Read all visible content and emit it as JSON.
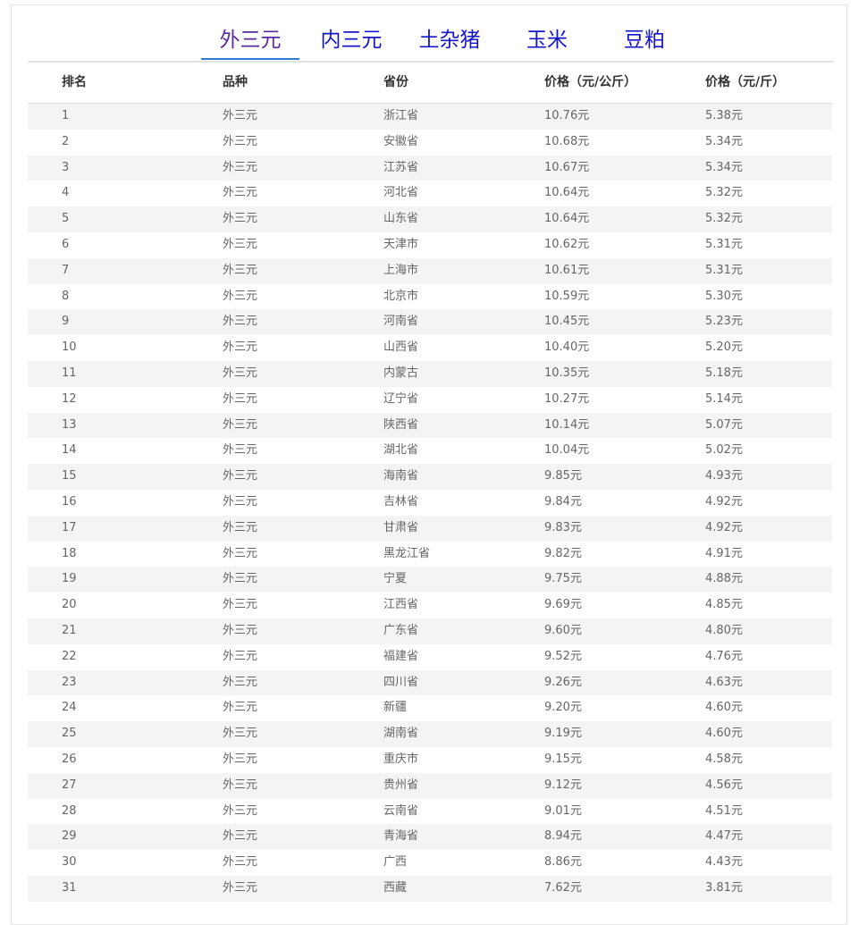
{
  "tabs": [
    {
      "label": "外三元",
      "active": true
    },
    {
      "label": "内三元",
      "active": false
    },
    {
      "label": "土杂猪",
      "active": false
    },
    {
      "label": "玉米",
      "active": false
    },
    {
      "label": "豆粕",
      "active": false
    }
  ],
  "table": {
    "headers": [
      "排名",
      "品种",
      "省份",
      "价格（元/公斤）",
      "价格（元/斤）"
    ],
    "rows": [
      [
        "1",
        "外三元",
        "浙江省",
        "10.76元",
        "5.38元"
      ],
      [
        "2",
        "外三元",
        "安徽省",
        "10.68元",
        "5.34元"
      ],
      [
        "3",
        "外三元",
        "江苏省",
        "10.67元",
        "5.34元"
      ],
      [
        "4",
        "外三元",
        "河北省",
        "10.64元",
        "5.32元"
      ],
      [
        "5",
        "外三元",
        "山东省",
        "10.64元",
        "5.32元"
      ],
      [
        "6",
        "外三元",
        "天津市",
        "10.62元",
        "5.31元"
      ],
      [
        "7",
        "外三元",
        "上海市",
        "10.61元",
        "5.31元"
      ],
      [
        "8",
        "外三元",
        "北京市",
        "10.59元",
        "5.30元"
      ],
      [
        "9",
        "外三元",
        "河南省",
        "10.45元",
        "5.23元"
      ],
      [
        "10",
        "外三元",
        "山西省",
        "10.40元",
        "5.20元"
      ],
      [
        "11",
        "外三元",
        "内蒙古",
        "10.35元",
        "5.18元"
      ],
      [
        "12",
        "外三元",
        "辽宁省",
        "10.27元",
        "5.14元"
      ],
      [
        "13",
        "外三元",
        "陕西省",
        "10.14元",
        "5.07元"
      ],
      [
        "14",
        "外三元",
        "湖北省",
        "10.04元",
        "5.02元"
      ],
      [
        "15",
        "外三元",
        "海南省",
        "9.85元",
        "4.93元"
      ],
      [
        "16",
        "外三元",
        "吉林省",
        "9.84元",
        "4.92元"
      ],
      [
        "17",
        "外三元",
        "甘肃省",
        "9.83元",
        "4.92元"
      ],
      [
        "18",
        "外三元",
        "黑龙江省",
        "9.82元",
        "4.91元"
      ],
      [
        "19",
        "外三元",
        "宁夏",
        "9.75元",
        "4.88元"
      ],
      [
        "20",
        "外三元",
        "江西省",
        "9.69元",
        "4.85元"
      ],
      [
        "21",
        "外三元",
        "广东省",
        "9.60元",
        "4.80元"
      ],
      [
        "22",
        "外三元",
        "福建省",
        "9.52元",
        "4.76元"
      ],
      [
        "23",
        "外三元",
        "四川省",
        "9.26元",
        "4.63元"
      ],
      [
        "24",
        "外三元",
        "新疆",
        "9.20元",
        "4.60元"
      ],
      [
        "25",
        "外三元",
        "湖南省",
        "9.19元",
        "4.60元"
      ],
      [
        "26",
        "外三元",
        "重庆市",
        "9.15元",
        "4.58元"
      ],
      [
        "27",
        "外三元",
        "贵州省",
        "9.12元",
        "4.56元"
      ],
      [
        "28",
        "外三元",
        "云南省",
        "9.01元",
        "4.51元"
      ],
      [
        "29",
        "外三元",
        "青海省",
        "8.94元",
        "4.47元"
      ],
      [
        "30",
        "外三元",
        "广西",
        "8.86元",
        "4.43元"
      ],
      [
        "31",
        "外三元",
        "西藏",
        "7.62元",
        "3.81元"
      ]
    ]
  },
  "colors": {
    "tab_text": "#1515c8",
    "tab_active_text": "#5b2aa0",
    "tab_active_underline": "#2a7fd4",
    "row_stripe": "#f4f4f4"
  }
}
